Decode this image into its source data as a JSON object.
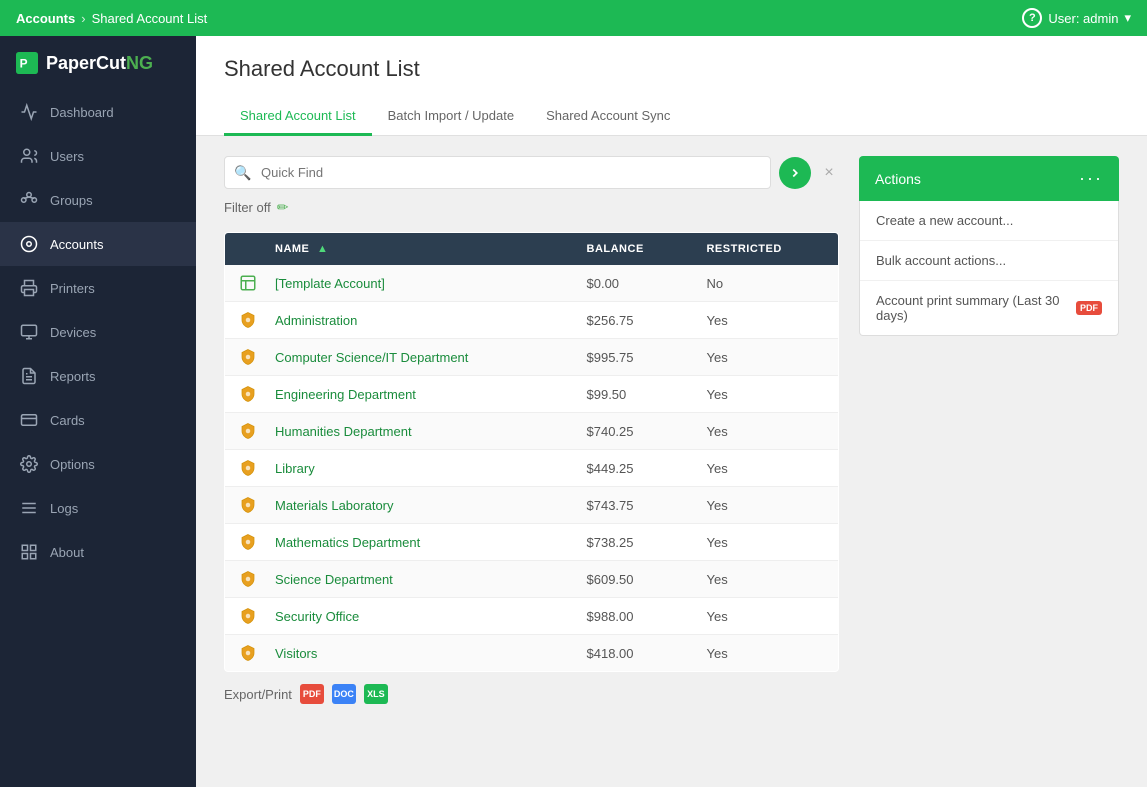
{
  "topbar": {
    "breadcrumb_root": "Accounts",
    "breadcrumb_current": "Shared Account List",
    "help_label": "?",
    "user_label": "User: admin"
  },
  "sidebar": {
    "logo_text": "PaperCut",
    "logo_ng": "NG",
    "items": [
      {
        "id": "dashboard",
        "label": "Dashboard",
        "icon": "dashboard"
      },
      {
        "id": "users",
        "label": "Users",
        "icon": "users"
      },
      {
        "id": "groups",
        "label": "Groups",
        "icon": "groups"
      },
      {
        "id": "accounts",
        "label": "Accounts",
        "icon": "accounts",
        "active": true
      },
      {
        "id": "printers",
        "label": "Printers",
        "icon": "printers"
      },
      {
        "id": "devices",
        "label": "Devices",
        "icon": "devices"
      },
      {
        "id": "reports",
        "label": "Reports",
        "icon": "reports"
      },
      {
        "id": "cards",
        "label": "Cards",
        "icon": "cards"
      },
      {
        "id": "options",
        "label": "Options",
        "icon": "options"
      },
      {
        "id": "logs",
        "label": "Logs",
        "icon": "logs"
      },
      {
        "id": "about",
        "label": "About",
        "icon": "about"
      }
    ]
  },
  "page": {
    "title": "Shared Account List",
    "tabs": [
      {
        "id": "shared-account-list",
        "label": "Shared Account List",
        "active": true
      },
      {
        "id": "batch-import",
        "label": "Batch Import / Update",
        "active": false
      },
      {
        "id": "shared-account-sync",
        "label": "Shared Account Sync",
        "active": false
      }
    ]
  },
  "search": {
    "placeholder": "Quick Find",
    "filter_label": "Filter off"
  },
  "table": {
    "columns": [
      {
        "id": "icon",
        "label": ""
      },
      {
        "id": "name",
        "label": "NAME",
        "sorted": true
      },
      {
        "id": "balance",
        "label": "BALANCE"
      },
      {
        "id": "restricted",
        "label": "RESTRICTED"
      }
    ],
    "rows": [
      {
        "icon": "template",
        "name": "[Template Account]",
        "balance": "$0.00",
        "restricted": "No"
      },
      {
        "icon": "shield",
        "name": "Administration",
        "balance": "$256.75",
        "restricted": "Yes"
      },
      {
        "icon": "shield",
        "name": "Computer Science/IT Department",
        "balance": "$995.75",
        "restricted": "Yes"
      },
      {
        "icon": "shield",
        "name": "Engineering Department",
        "balance": "$99.50",
        "restricted": "Yes"
      },
      {
        "icon": "shield",
        "name": "Humanities Department",
        "balance": "$740.25",
        "restricted": "Yes"
      },
      {
        "icon": "shield",
        "name": "Library",
        "balance": "$449.25",
        "restricted": "Yes"
      },
      {
        "icon": "shield",
        "name": "Materials Laboratory",
        "balance": "$743.75",
        "restricted": "Yes"
      },
      {
        "icon": "shield",
        "name": "Mathematics Department",
        "balance": "$738.25",
        "restricted": "Yes"
      },
      {
        "icon": "shield",
        "name": "Science Department",
        "balance": "$609.50",
        "restricted": "Yes"
      },
      {
        "icon": "shield",
        "name": "Security Office",
        "balance": "$988.00",
        "restricted": "Yes"
      },
      {
        "icon": "shield",
        "name": "Visitors",
        "balance": "$418.00",
        "restricted": "Yes"
      }
    ]
  },
  "export": {
    "label": "Export/Print",
    "pdf_label": "PDF",
    "doc_label": "DOC",
    "xls_label": "XLS"
  },
  "actions": {
    "header_label": "Actions",
    "items": [
      {
        "id": "create-account",
        "label": "Create a new account...",
        "badge": null
      },
      {
        "id": "bulk-actions",
        "label": "Bulk account actions...",
        "badge": null
      },
      {
        "id": "print-summary",
        "label": "Account print summary (Last 30 days)",
        "badge": "PDF"
      }
    ]
  }
}
